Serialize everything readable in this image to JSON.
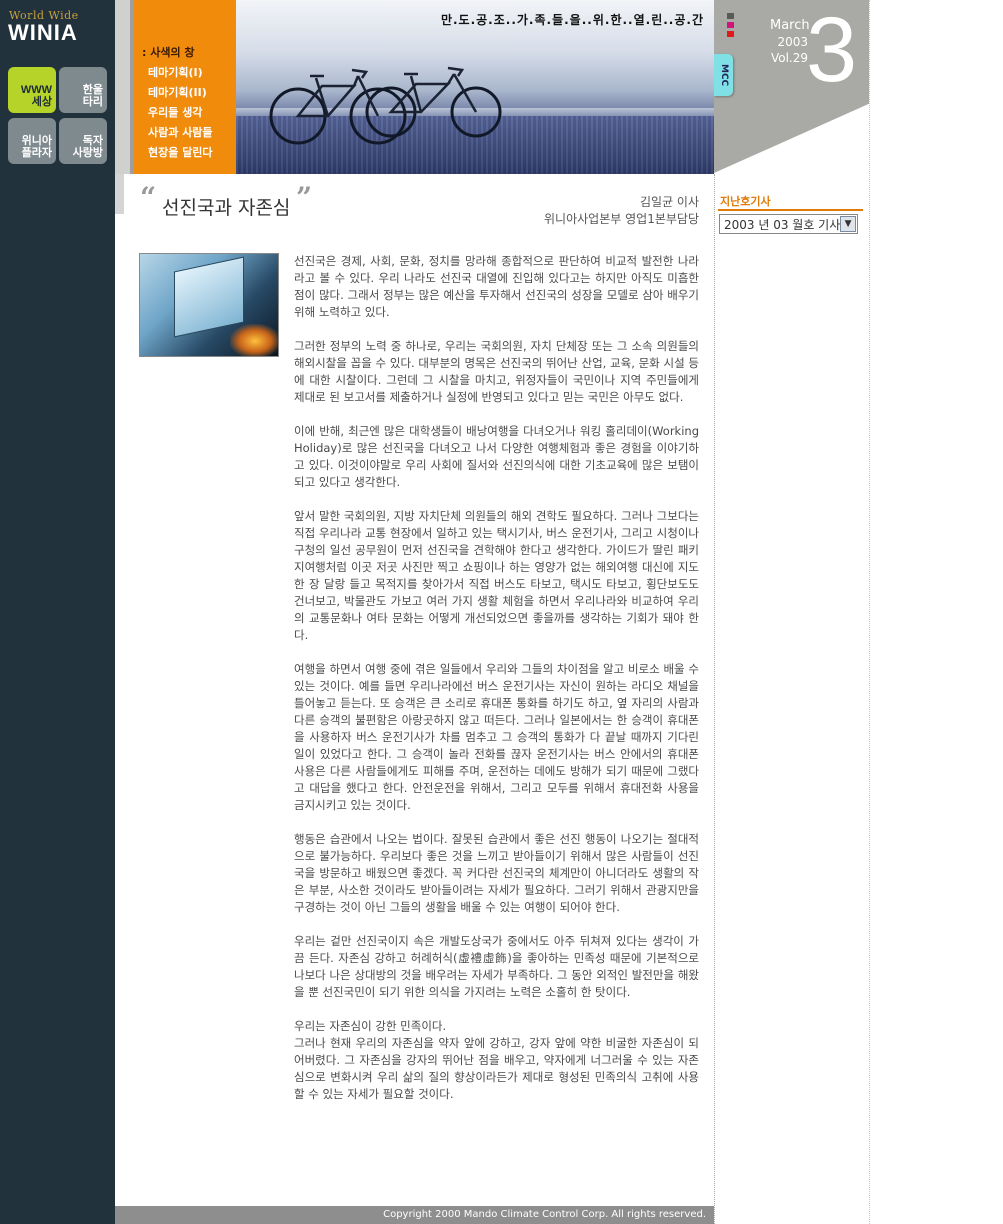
{
  "brand": {
    "small": "World Wide",
    "main": "WINIA"
  },
  "nav_buttons": [
    {
      "label": "WWW\n세상",
      "active": true
    },
    {
      "label": "한울\n타리",
      "active": false
    },
    {
      "label": "위니아\n플라자",
      "active": false
    },
    {
      "label": "독자\n사랑방",
      "active": false
    }
  ],
  "menu": {
    "title": ": 사색의 창",
    "items": [
      "테마기획(I)",
      "테마기획(II)",
      "우리들 생각",
      "사람과 사람들",
      "현장을 달린다"
    ]
  },
  "banner": {
    "slogan": "만.도.공.조..가.족.들.을..위.한..열.린..공.간"
  },
  "issue": {
    "month": "March",
    "year": "2003",
    "vol": "Vol.29",
    "number": "3",
    "tab": "MCC"
  },
  "past_issues": {
    "title": "지난호기사",
    "selected": "2003 년 03 월호 기사"
  },
  "article": {
    "title": "선진국과 자존심",
    "author": "김일균 이사",
    "department": "위니아사업본부 영업1본부담당",
    "paragraphs": [
      "선진국은 경제, 사회, 문화, 정치를 망라해 종합적으로 판단하여 비교적 발전한 나라라고 볼 수 있다. 우리 나라도 선진국 대열에 진입해 있다고는 하지만 아직도 미흡한 점이 많다. 그래서 정부는 많은 예산을 투자해서 선진국의 성장을 모델로 삼아 배우기 위해 노력하고 있다.",
      "그러한 정부의 노력 중 하나로, 우리는 국회의원, 자치 단체장 또는 그 소속 의원들의 해외시찰을 꼽을 수 있다. 대부분의 명목은 선진국의 뛰어난 산업, 교육, 문화 시설 등에 대한 시찰이다. 그런데 그 시찰을 마치고, 위정자들이 국민이나 지역 주민들에게 제대로 된 보고서를 제출하거나 실정에 반영되고 있다고 믿는 국민은 아무도 없다.",
      "이에 반해, 최근엔 많은 대학생들이 배낭여행을 다녀오거나 워킹 홀리데이(Working Holiday)로 많은 선진국을 다녀오고 나서 다양한 여행체험과 좋은 경험을 이야기하고 있다. 이것이야말로 우리 사회에 질서와 선진의식에 대한 기초교육에 많은 보탬이 되고 있다고 생각한다.",
      "앞서 말한 국회의원, 지방 자치단체 의원들의 해외 견학도 필요하다. 그러나 그보다는 직접 우리나라 교통 현장에서 일하고 있는 택시기사, 버스 운전기사, 그리고 시청이나 구청의 일선 공무원이 먼저 선진국을 견학해야 한다고 생각한다. 가이드가 딸린 패키지여행처럼 이곳 저곳 사진만 찍고 쇼핑이나 하는 영양가 없는 해외여행 대신에 지도 한 장 달랑 들고 목적지를 찾아가서 직접 버스도 타보고, 택시도 타보고, 횡단보도도 건너보고, 박물관도 가보고 여러 가지 생활 체험을 하면서 우리나라와 비교하여 우리의 교통문화나 여타 문화는 어떻게 개선되었으면 좋을까를 생각하는 기회가 돼야 한다.",
      "여행을 하면서 여행 중에 겪은 일들에서 우리와 그들의 차이점을 알고 비로소 배울 수 있는 것이다. 예를 들면 우리나라에선 버스 운전기사는 자신이 원하는 라디오 채널을 틀어놓고 듣는다. 또 승객은 큰 소리로 휴대폰 통화를 하기도 하고, 옆 자리의 사람과 다른 승객의 불편함은 아랑곳하지 않고 떠든다. 그러나 일본에서는 한 승객이 휴대폰을 사용하자 버스 운전기사가 차를 멈추고 그 승객의 통화가 다 끝날 때까지 기다린 일이 있었다고 한다. 그 승객이 놀라 전화를 끊자 운전기사는 버스 안에서의 휴대폰 사용은 다른 사람들에게도 피해를 주며, 운전하는 데에도 방해가 되기 때문에 그랬다고 대답을 했다고 한다. 안전운전을 위해서, 그리고 모두를 위해서 휴대전화 사용을 금지시키고 있는 것이다.",
      "행동은 습관에서 나오는 법이다. 잘못된 습관에서 좋은 선진 행동이 나오기는 절대적으로 불가능하다. 우리보다 좋은 것을 느끼고 받아들이기 위해서 많은 사람들이 선진국을 방문하고 배웠으면 좋겠다. 꼭 커다란 선진국의 체계만이 아니더라도 생활의 작은 부분, 사소한 것이라도 받아들이려는 자세가 필요하다. 그러기 위해서 관광지만을 구경하는 것이 아닌 그들의 생활을 배울 수 있는 여행이 되어야 한다.",
      "우리는 겉만 선진국이지 속은 개발도상국가 중에서도 아주 뒤쳐져 있다는 생각이 가끔 든다. 자존심 강하고 허례허식(虛禮虛飾)을 좋아하는 민족성 때문에 기본적으로 나보다 나은 상대방의 것을 배우려는 자세가 부족하다. 그 동안 외적인 발전만을 해왔을 뿐 선진국민이 되기 위한 의식을 가지려는 노력은 소홀히 한 탓이다.",
      "우리는 자존심이 강한 민족이다.\n그러나 현재 우리의 자존심을 약자 앞에 강하고, 강자 앞에 약한 비굴한 자존심이 되어버렸다. 그 자존심을 강자의 뛰어난 점을 배우고, 약자에게 너그러울 수 있는 자존심으로 변화시켜 우리 삶의 질의 향상이라든가 제대로 형성된 민족의식 고취에 사용할 수 있는 자세가 필요할 것이다."
    ]
  },
  "footer": {
    "copyright": "Copyright  2000 Mando Climate Control Corp. All rights reserved."
  },
  "colors": {
    "sidebar": "#22323d",
    "accent_orange": "#f18b0c",
    "nav_active": "#b5d329",
    "panel_gray": "#a9aaa6"
  }
}
